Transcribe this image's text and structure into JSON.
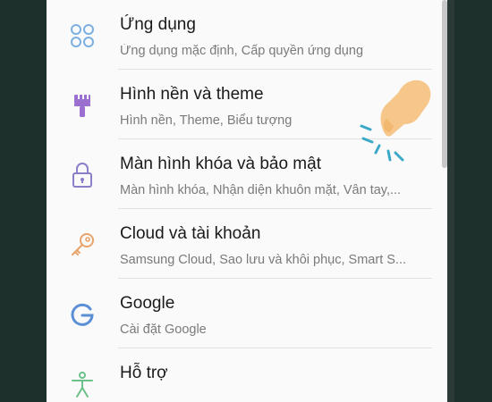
{
  "settings": {
    "items": [
      {
        "title": "Ứng dụng",
        "subtitle": "Ứng dụng mặc định, Cấp quyền ứng dụng",
        "icon": "apps-grid-icon",
        "color": "#7bb0e0"
      },
      {
        "title": "Hình nền và theme",
        "subtitle": "Hình nền, Theme, Biểu tượng",
        "icon": "paintbrush-icon",
        "color": "#9b6fcf"
      },
      {
        "title": "Màn hình khóa và bảo mật",
        "subtitle": "Màn hình khóa, Nhận diện khuôn mặt, Vân tay,...",
        "icon": "lock-icon",
        "color": "#8a7fc9"
      },
      {
        "title": "Cloud và tài khoản",
        "subtitle": "Samsung Cloud, Sao lưu và khôi phục, Smart S...",
        "icon": "key-icon",
        "color": "#e8a36a"
      },
      {
        "title": "Google",
        "subtitle": "Cài đặt Google",
        "icon": "google-icon",
        "color": "#5b8fd6"
      },
      {
        "title": "Hỗ trợ",
        "subtitle": "",
        "icon": "accessibility-icon",
        "color": "#6cc08a"
      }
    ]
  },
  "overlay": {
    "icon": "pointing-hand-icon",
    "color": "#f6c68a",
    "tap_color": "#3aa9c8"
  }
}
